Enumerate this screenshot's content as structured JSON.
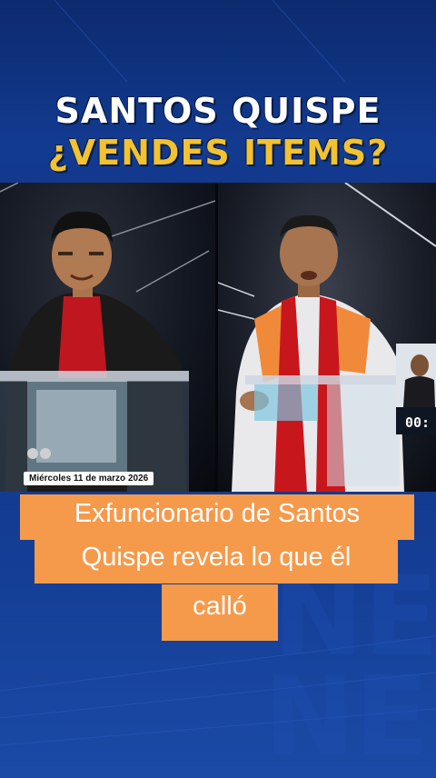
{
  "headline": {
    "line1": "SANTOS QUISPE",
    "line2": "¿VENDES ITEMS?"
  },
  "video": {
    "date_label": "Miércoles 11 de marzo 2026",
    "timer": "00:"
  },
  "caption": {
    "line1": "Exfuncionario de Santos",
    "line2": "Quispe revela lo que él",
    "line3": "calló"
  },
  "colors": {
    "headline_white": "#ffffff",
    "headline_yellow": "#f2c230",
    "caption_bg": "#f59a4b",
    "background": "#123a8f"
  }
}
